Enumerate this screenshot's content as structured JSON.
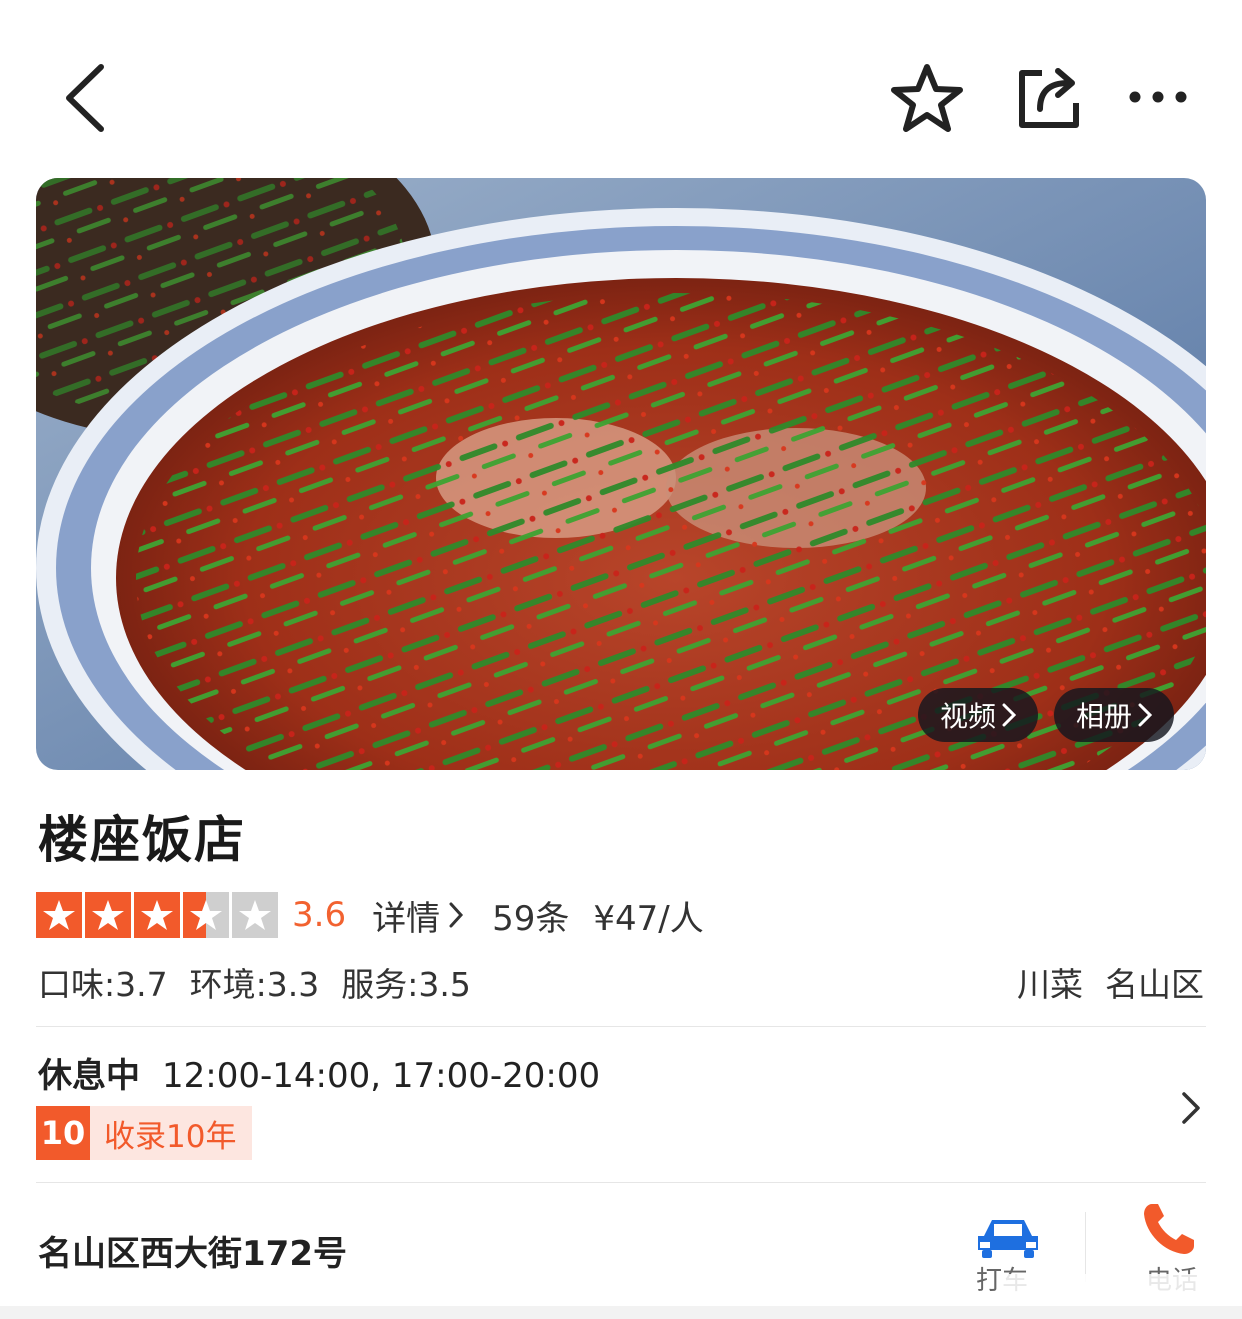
{
  "header": {
    "back_icon": "chevron-left-icon",
    "favorite_icon": "star-outline-icon",
    "share_icon": "share-icon",
    "more_icon": "more-dots-icon"
  },
  "hero": {
    "video_label": "视频",
    "album_label": "相册"
  },
  "restaurant": {
    "name": "楼座饭店",
    "rating": {
      "stars_value": 3.5,
      "stars_max": 5,
      "score": "3.6",
      "detail_label": "详情",
      "review_count": "59条",
      "price": "¥47/人"
    },
    "subscores": {
      "taste": "口味:3.7",
      "environment": "环境:3.3",
      "service": "服务:3.5"
    },
    "tags": {
      "cuisine": "川菜",
      "district": "名山区"
    },
    "hours": {
      "status": "休息中",
      "times": "12:00-14:00, 17:00-20:00"
    },
    "badge": {
      "number": "10",
      "text": "收录10年"
    },
    "address": "名山区西大街172号",
    "actions": {
      "taxi_label": "打车",
      "phone_label": "电话"
    }
  },
  "colors": {
    "accent": "#f25a2b",
    "score": "#f26230",
    "taxi": "#1e6fe0",
    "phone": "#f25a2b"
  }
}
